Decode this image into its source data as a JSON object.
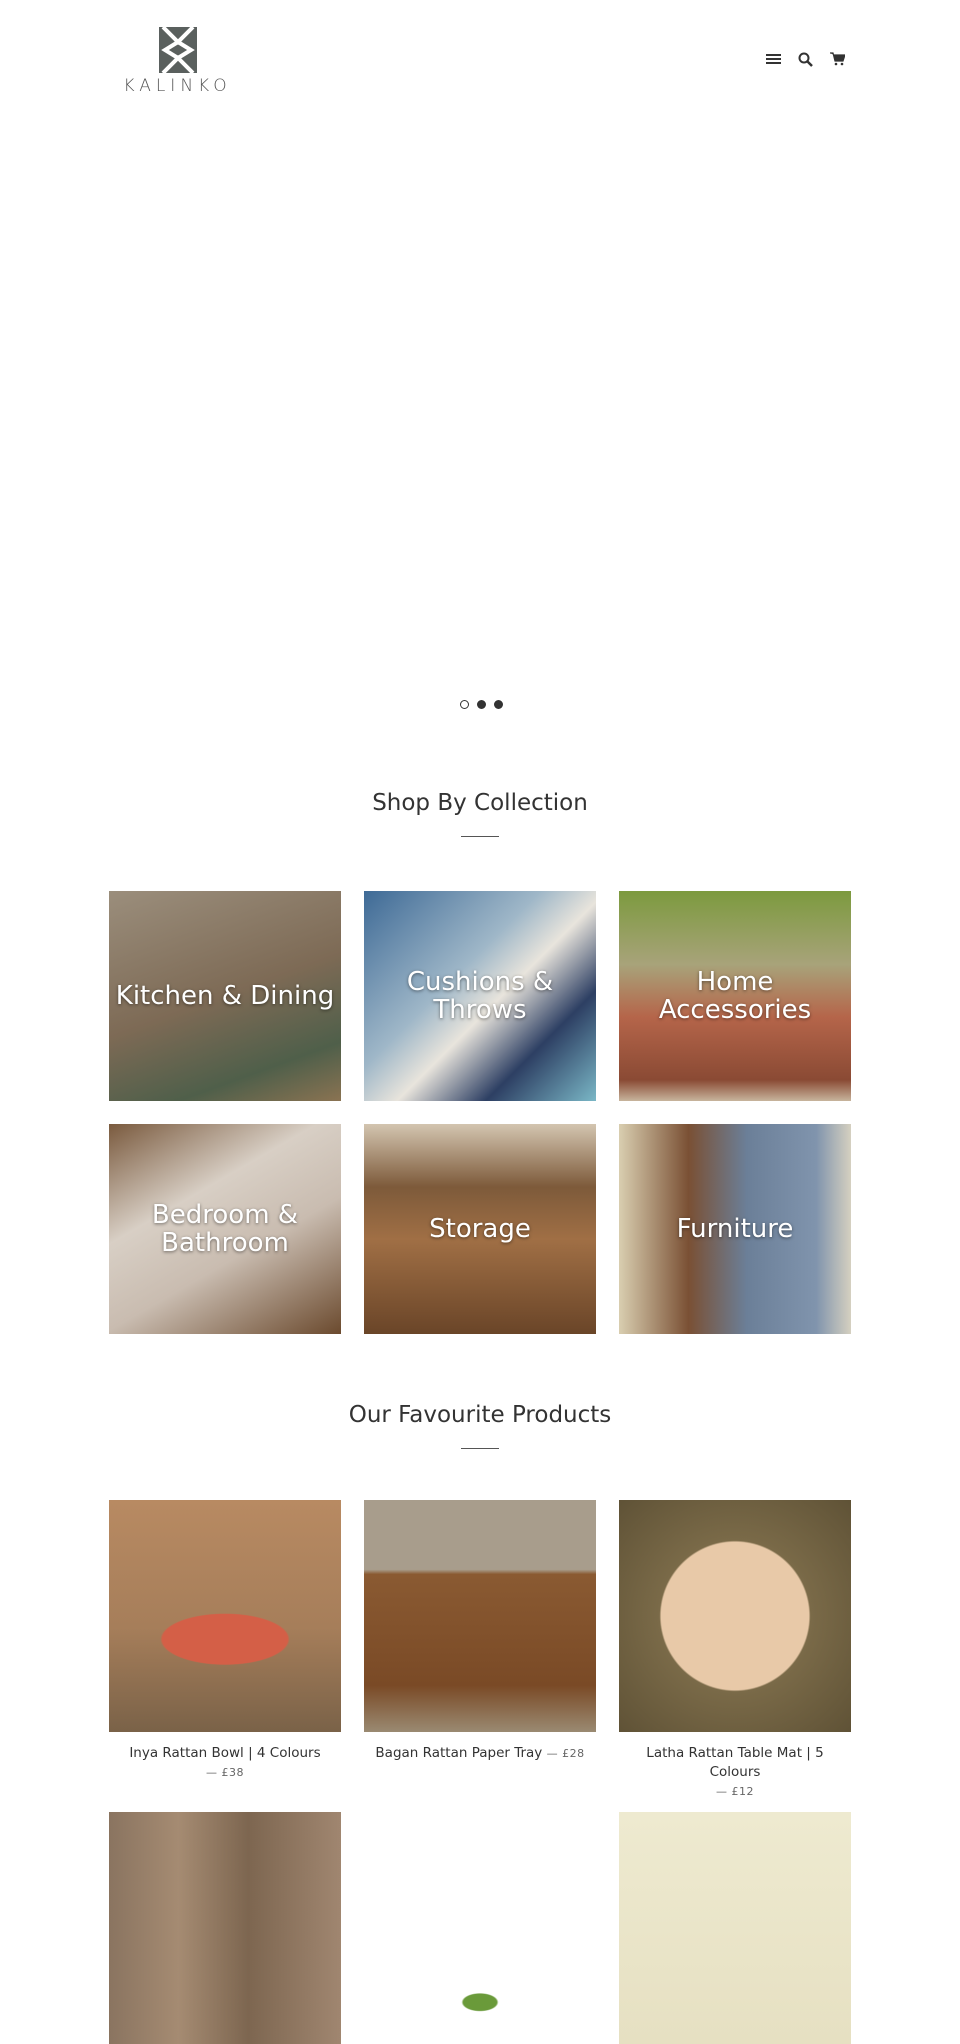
{
  "header": {
    "brand": "KALINKO",
    "icons": [
      "menu-icon",
      "search-icon",
      "cart-icon"
    ]
  },
  "slider": {
    "slides": 3,
    "active": 1
  },
  "collections": {
    "title": "Shop By Collection",
    "items": [
      {
        "label": "Kitchen & Dining"
      },
      {
        "label": "Cushions & Throws"
      },
      {
        "label": "Home Accessories"
      },
      {
        "label": "Bedroom & Bathroom"
      },
      {
        "label": "Storage"
      },
      {
        "label": "Furniture"
      }
    ]
  },
  "products": {
    "title": "Our Favourite Products",
    "items": [
      {
        "name": "Inya Rattan Bowl | 4 Colours",
        "price": "£38"
      },
      {
        "name": "Bagan Rattan Paper Tray",
        "price": "£28"
      },
      {
        "name": "Latha Rattan Table Mat | 5 Colours",
        "price": "£12"
      }
    ],
    "dash": "—"
  }
}
